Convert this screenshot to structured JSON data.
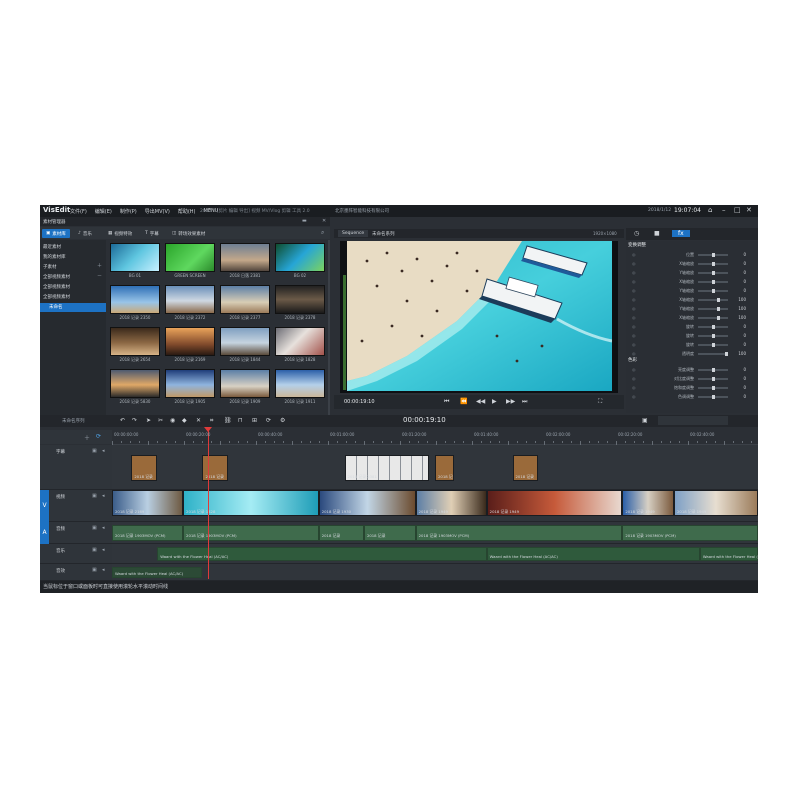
{
  "app": {
    "logo": "VisEdit",
    "menu": [
      "文件(F)",
      "编辑(E)",
      "制作(P)",
      "导出MV(V)",
      "帮助(H)",
      "MENU"
    ],
    "menu_hint": "2022  *  [剪片 编辑 导出]  视频 MV/Vlog 剪辑 工具 2.0",
    "company": "北京墨阵智能科技有限公司",
    "date": "2018/1/12",
    "timecode": "19:07:04",
    "window_controls": [
      "⌂",
      "–",
      "□",
      "✕"
    ]
  },
  "library": {
    "title": "素材管理器",
    "tabs": [
      {
        "label": "素材库",
        "icon": "media-icon",
        "active": true
      },
      {
        "label": "音乐",
        "icon": "music-icon",
        "active": false
      },
      {
        "label": "视频特效",
        "icon": "effect-icon",
        "active": false
      },
      {
        "label": "字幕",
        "icon": "text-icon",
        "active": false
      },
      {
        "label": "转场效果素材",
        "icon": "transition-icon",
        "active": false
      }
    ],
    "sidebar": [
      {
        "label": "最近素材",
        "selected": false
      },
      {
        "label": "我的素材库",
        "selected": false
      },
      {
        "label": "子素材",
        "selected": false
      },
      {
        "label": "全部视频素材",
        "selected": false
      },
      {
        "label": "全部视频素材",
        "selected": false
      },
      {
        "label": "全部视频素材",
        "selected": false
      },
      {
        "label": "未命名",
        "selected": true
      }
    ],
    "thumbnails": [
      {
        "caption": "BG 01",
        "bg": "linear-gradient(135deg,#1c6a98,#5fc6e0 50%,#c7f0ff)"
      },
      {
        "caption": "GREEN SCREEN",
        "bg": "linear-gradient(135deg,#2aa52a,#5fd85f 60%,#2b8a2b)"
      },
      {
        "caption": "2018 日落 2381",
        "bg": "linear-gradient(180deg,#6e7f93,#c3a88a 60%,#52463d)"
      },
      {
        "caption": "BG 02",
        "bg": "linear-gradient(135deg,#0f4d2e,#26a5d6 50%,#7cd35e)"
      },
      {
        "caption": "2018 记录 2350",
        "bg": "linear-gradient(180deg,#2f6fb6,#98c4e8 60%,#caa978)"
      },
      {
        "caption": "2018 记录 2372",
        "bg": "linear-gradient(180deg,#6a8fb9,#cfd8e2 55%,#8b6b4c)"
      },
      {
        "caption": "2018 记录 2377",
        "bg": "linear-gradient(180deg,#5d7fa6,#d8cdb5 60%,#9b7b5a)"
      },
      {
        "caption": "2018 记录 2378",
        "bg": "linear-gradient(180deg,#222,#6b5a48 50%,#1a1a1a)"
      },
      {
        "caption": "2018 记录 2654",
        "bg": "linear-gradient(180deg,#3b2a1c,#8c6844 55%,#d8b487)"
      },
      {
        "caption": "2018 记录 2169",
        "bg": "linear-gradient(180deg,#e9a35a,#824b2c 60%,#2a1a12)"
      },
      {
        "caption": "2018 记录 1844",
        "bg": "linear-gradient(180deg,#7f9fc0,#c6d4e0 55%,#5a4a3a)"
      },
      {
        "caption": "2018 记录 1828",
        "bg": "linear-gradient(135deg,#6d6d75,#e7e1dc 45%,#a3524b)"
      },
      {
        "caption": "2018 记录 5830",
        "bg": "linear-gradient(180deg,#4d5a70,#e0a867 55%,#2a2a2a)"
      },
      {
        "caption": "2018 记录 1905",
        "bg": "linear-gradient(180deg,#1f3d7a,#8fb4de 55%,#c09968)"
      },
      {
        "caption": "2018 记录 1909",
        "bg": "linear-gradient(180deg,#5a7ea6,#d8d1c4 60%,#7b5a3d)"
      },
      {
        "caption": "2018 记录 1911",
        "bg": "linear-gradient(180deg,#2b5fa8,#b4d0ea 55%,#cbb79a)"
      }
    ]
  },
  "preview": {
    "tabs": [
      {
        "label": "Sequence",
        "active": true
      },
      {
        "label": "未命名系列",
        "active": false
      }
    ],
    "resolution": "1920×1080",
    "timecode": "00:00:19:10",
    "controls": [
      "⏮",
      "⏪",
      "◀◀",
      "▶",
      "▶▶",
      "⏭"
    ]
  },
  "properties": {
    "tabs": [
      {
        "icon": "clock-icon",
        "active": false
      },
      {
        "icon": "camera-icon",
        "active": false
      },
      {
        "icon": "fx-icon",
        "active": true
      }
    ],
    "section1": {
      "title": "变换调整",
      "rows": [
        {
          "label": "位置",
          "value": "0",
          "level": 0.5
        },
        {
          "label": "X轴缩放",
          "value": "0",
          "level": 0.5
        },
        {
          "label": "Y轴缩放",
          "value": "0",
          "level": 0.5
        },
        {
          "label": "X轴缩放",
          "value": "0",
          "level": 0.5
        },
        {
          "label": "Y轴缩放",
          "value": "0",
          "level": 0.5
        },
        {
          "label": "X轴缩放",
          "value": "100",
          "level": 0.7
        },
        {
          "label": "Y轴缩放",
          "value": "100",
          "level": 0.7
        },
        {
          "label": "X轴缩放",
          "value": "100",
          "level": 0.7
        },
        {
          "label": "旋转",
          "value": "0",
          "level": 0.5
        },
        {
          "label": "旋转",
          "value": "0",
          "level": 0.5
        },
        {
          "label": "旋转",
          "value": "0",
          "level": 0.5
        },
        {
          "label": "透明度",
          "value": "100",
          "level": 1.0
        }
      ]
    },
    "section2": {
      "title": "色彩",
      "rows": [
        {
          "label": "亮度调整",
          "value": "0",
          "level": 0.5
        },
        {
          "label": "对比度调整",
          "value": "0",
          "level": 0.5
        },
        {
          "label": "饱和度调整",
          "value": "0",
          "level": 0.5
        },
        {
          "label": "色调调整",
          "value": "0",
          "level": 0.5
        }
      ]
    }
  },
  "timeline": {
    "sequence_label": "未命名序列",
    "timecode": "00:00:19:10",
    "ruler": [
      "00:00:00:00",
      "00:00:20:00",
      "00:00:40:00",
      "00:01:00:00",
      "00:01:20:00",
      "00:01:40:00",
      "00:02:00:00",
      "00:02:20:00",
      "00:02:40:00"
    ],
    "tracks": [
      {
        "name": "字幕",
        "tag": ""
      },
      {
        "name": "视频",
        "tag": "V"
      },
      {
        "name": "音频",
        "tag": "A"
      },
      {
        "name": "音乐",
        "tag": ""
      },
      {
        "name": "音效",
        "tag": ""
      }
    ],
    "title_clips": [
      {
        "label": "2018 记录",
        "start": 0.03,
        "end": 0.07
      },
      {
        "label": "2018 记录",
        "start": 0.14,
        "end": 0.18
      },
      {
        "label": "2018 记录 2381",
        "start": 0.36,
        "end": 0.49
      },
      {
        "label": "2018 记录",
        "start": 0.5,
        "end": 0.53
      },
      {
        "label": "2018 记录",
        "start": 0.62,
        "end": 0.66
      }
    ],
    "video_clips": [
      {
        "label": "2018 记录 2169",
        "start": 0.0,
        "end": 0.11,
        "bg": "linear-gradient(90deg,#3b5d8a,#b9cfe2,#6e5a42)"
      },
      {
        "label": "2018 记录 1828",
        "start": 0.11,
        "end": 0.32,
        "bg": "linear-gradient(90deg,#2fb2c8,#a5ecf4,#1e9db7)"
      },
      {
        "label": "2018 记录 1930",
        "start": 0.32,
        "end": 0.47,
        "bg": "linear-gradient(90deg,#2b4a7e,#c2d6e6,#6b4b2e)"
      },
      {
        "label": "2018 记录 1949",
        "start": 0.47,
        "end": 0.58,
        "bg": "linear-gradient(90deg,#5d7fa6,#e0cfb5,#3a2a1c)"
      },
      {
        "label": "2018 记录 1949",
        "start": 0.58,
        "end": 0.79,
        "bg": "linear-gradient(90deg,#5a1e1a,#c65a3a,#e8d8cf)"
      },
      {
        "label": "2018 记录 1949",
        "start": 0.79,
        "end": 0.87,
        "bg": "linear-gradient(90deg,#2b5fa8,#d7d0c4,#7b5a3d)"
      },
      {
        "label": "2018 记录 1949",
        "start": 0.87,
        "end": 1.0,
        "bg": "linear-gradient(90deg,#7ea0c6,#e7ded0,#9b7b5a)"
      }
    ],
    "audio_clips": [
      {
        "label": "2018 记录 1903MOV (PCM)",
        "start": 0.0,
        "end": 0.11
      },
      {
        "label": "2018 记录 1903MOV (PCM)",
        "start": 0.11,
        "end": 0.32
      },
      {
        "label": "2018 记录",
        "start": 0.32,
        "end": 0.39
      },
      {
        "label": "2018 记录",
        "start": 0.39,
        "end": 0.47
      },
      {
        "label": "2018 记录 1903MOV (PCM)",
        "start": 0.47,
        "end": 0.79
      },
      {
        "label": "2018 记录 1903MOV (PCM)",
        "start": 0.79,
        "end": 1.0
      }
    ],
    "music_clips": [
      {
        "label": "Waard with the Flower Heal (AC/AC)",
        "start": 0.07,
        "end": 0.58
      },
      {
        "label": "Waard with the Flower Heal (AC/AC)",
        "start": 0.58,
        "end": 0.91
      },
      {
        "label": "Waard with the Flower Heal (AC/AC)",
        "start": 0.91,
        "end": 1.0
      }
    ],
    "fx_clips": [
      {
        "label": "Waard with the Flower Heal (AC/AC)",
        "start": 0.0,
        "end": 0.14
      }
    ]
  },
  "status": {
    "text": "当鼠标位于窗口或面板时可直接使用滚轮水平滚动时间线"
  }
}
